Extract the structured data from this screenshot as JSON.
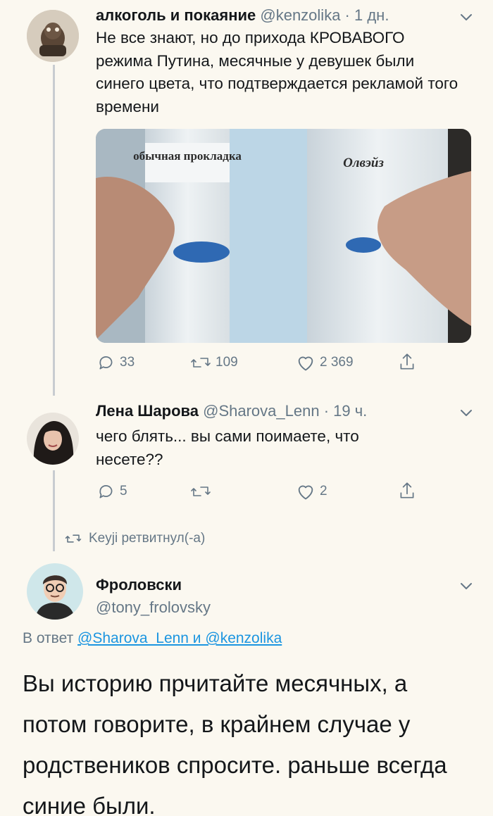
{
  "tweet1": {
    "display_name": "алкоголь и покаяние",
    "handle": "@kenzolika",
    "time": " · 1 дн.",
    "text": "Не все знают, но до прихода КРОВАВОГО режима Путина, месячные у девушек были синего цвета, что подтверждается рекламой того времени",
    "image_label_left": "обычная прокладка",
    "image_label_right": "Олвэйз",
    "replies": "33",
    "retweets": "109",
    "likes": "2 369"
  },
  "tweet2": {
    "display_name": "Лена Шарова",
    "handle": "@Sharova_Lenn",
    "time": " · 19 ч.",
    "text": "чего блять... вы сами поимаете, что несете??",
    "replies": "5",
    "retweets": "",
    "likes": "2"
  },
  "retweet_note": "Keyji ретвитнул(-а)",
  "tweet3": {
    "display_name": "Фроловски",
    "handle": "@tony_frolovsky",
    "reply_prefix": "В ответ ",
    "reply_mentions": "@Sharova_Lenn и @kenzolika",
    "text": "Вы историю прчитайте месячных, а потом говорите, в крайнем случае у родствеников спросите. раньше всегда синие были."
  },
  "colors": {
    "background": "#fbf8f0",
    "text": "#14171a",
    "muted": "#657786",
    "link": "#1b95e0",
    "thread_line": "#c8ccd0"
  },
  "icons": [
    "reply-icon",
    "retweet-icon",
    "like-icon",
    "share-icon",
    "chevron-down-icon"
  ]
}
